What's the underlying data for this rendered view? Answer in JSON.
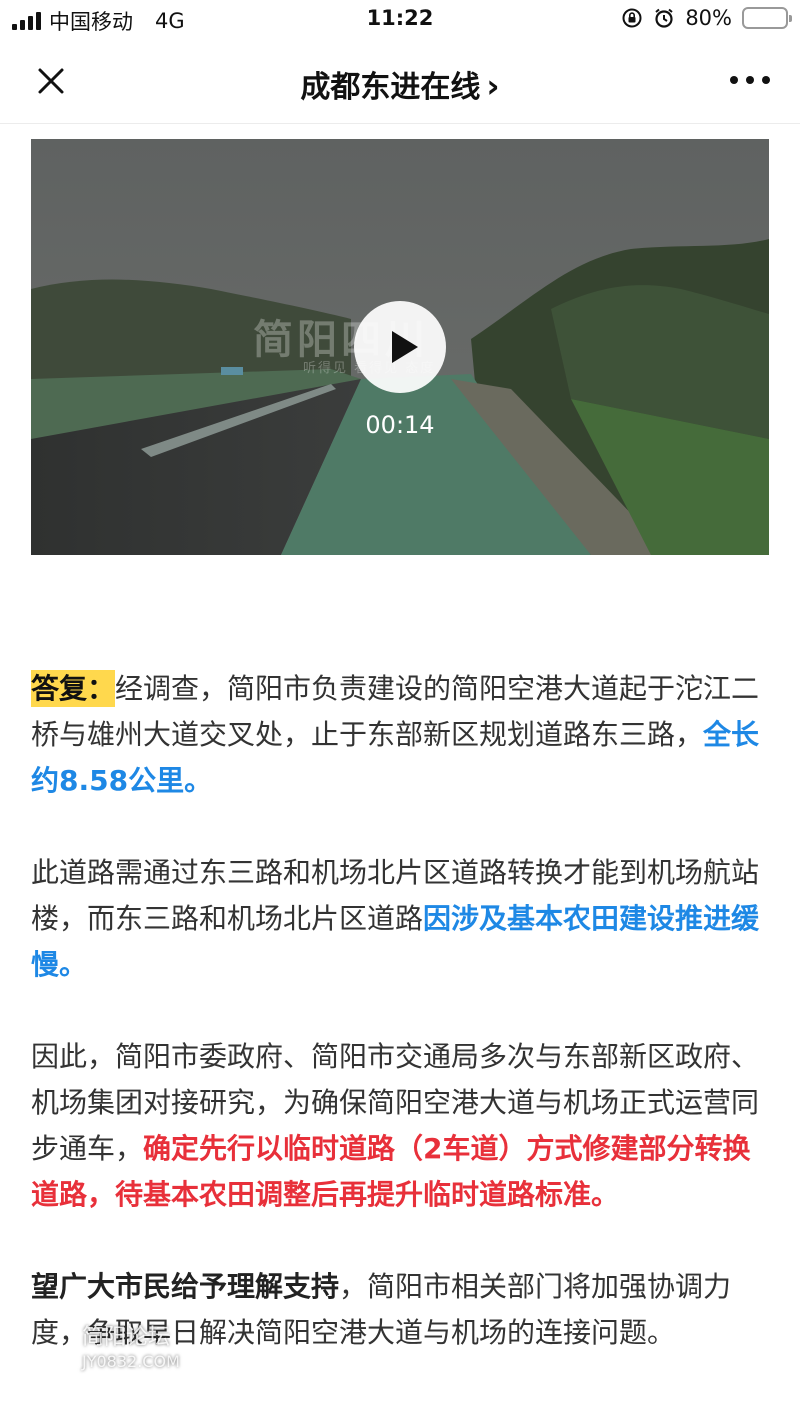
{
  "status_bar": {
    "carrier": "中国移动",
    "network": "4G",
    "time": "11:22",
    "battery": "80%",
    "battery_level": 0.8
  },
  "nav": {
    "title": "成都东进在线",
    "chevron": "›"
  },
  "video": {
    "watermark_logo": "简阳四川",
    "watermark_sub": "听得见 看得见 态度",
    "duration": "00:14"
  },
  "article": {
    "p1": {
      "label": "答复：",
      "text": "经调查，简阳市负责建设的简阳空港大道起于沱江二桥与雄州大道交叉处，止于东部新区规划道路东三路，",
      "highlight": "全长约8.58公里。"
    },
    "p2": {
      "text": "此道路需通过东三路和机场北片区道路转换才能到机场航站楼，而东三路和机场北片区道路",
      "highlight": "因涉及基本农田建设推进缓慢。"
    },
    "p3": {
      "text": "因此，简阳市委政府、简阳市交通局多次与东部新区政府、机场集团对接研究，为确保简阳空港大道与机场正式运营同步通车，",
      "highlight": "确定先行以临时道路（2车道）方式修建部分转换道路，待基本农田调整后再提升临时道路标准。"
    },
    "p4": {
      "bold": "望广大市民给予理解支持",
      "text": "，简阳市相关部门将加强协调力度，争取早日解决简阳空港大道与机场的连接问题。"
    }
  },
  "site_watermark": {
    "line1": "简阳论坛",
    "line2": "JY0832.COM"
  }
}
